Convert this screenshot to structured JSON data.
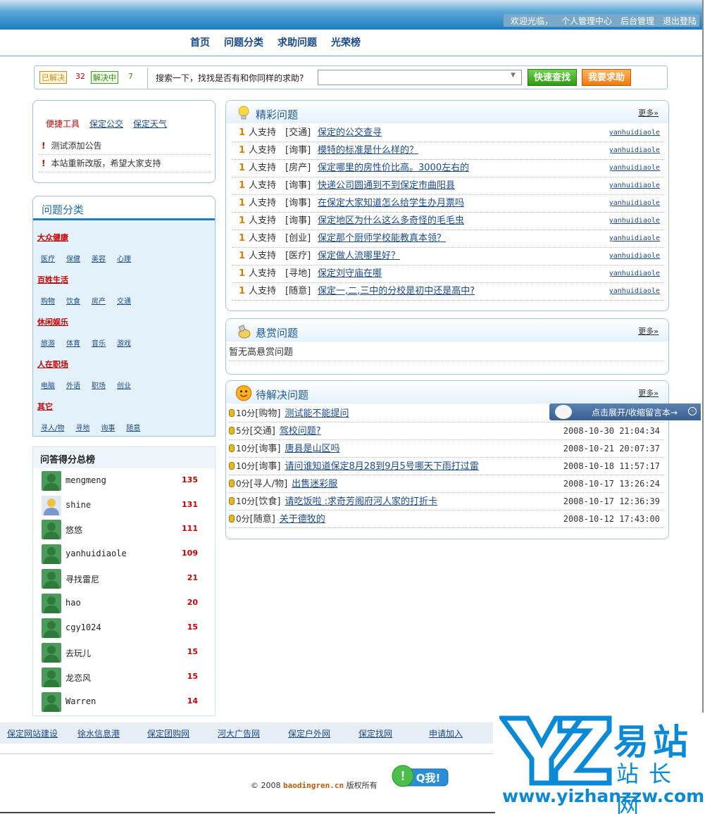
{
  "header": {
    "welcome": "欢迎光临，",
    "links": [
      "个人管理中心",
      "后台管理",
      "退出登陆"
    ]
  },
  "nav": [
    "首页",
    "问题分类",
    "求助问题",
    "光荣榜"
  ],
  "search": {
    "solved_label": "已解决",
    "solved_count": "32",
    "solving_label": "解决中",
    "solving_count": "7",
    "prompt": "搜索一下，找找是否有和你同样的求助?",
    "quick_button": "快速查找",
    "help_button": "我要求助"
  },
  "quick_tools": {
    "title": "便捷工具",
    "links": [
      "保定公交",
      "保定天气"
    ],
    "notices": [
      "测试添加公告",
      "本站重新改版，希望大家支持"
    ]
  },
  "categories": {
    "title": "问题分类",
    "groups": [
      {
        "name": "大众健康",
        "items": [
          "医疗",
          "保健",
          "美容",
          "心理"
        ]
      },
      {
        "name": "百姓生活",
        "items": [
          "购物",
          "饮食",
          "房产",
          "交通"
        ]
      },
      {
        "name": "休闲娱乐",
        "items": [
          "旅游",
          "体育",
          "音乐",
          "游戏"
        ]
      },
      {
        "name": "人在职场",
        "items": [
          "电脑",
          "外语",
          "职场",
          "创业"
        ]
      },
      {
        "name": "其它",
        "items": [
          "寻人/物",
          "寻地",
          "询事",
          "随意"
        ]
      }
    ]
  },
  "ranking": {
    "title": "问答得分总榜",
    "rows": [
      {
        "name": "mengmeng",
        "score": "135"
      },
      {
        "name": "shine",
        "score": "131"
      },
      {
        "name": "悠悠",
        "score": "111"
      },
      {
        "name": "yanhuidiaole",
        "score": "109"
      },
      {
        "name": "寻找雷尼",
        "score": "21"
      },
      {
        "name": "hao",
        "score": "20"
      },
      {
        "name": "cgy1024",
        "score": "15"
      },
      {
        "name": "去玩儿",
        "score": "15"
      },
      {
        "name": "龙恋风",
        "score": "15"
      },
      {
        "name": "Warren",
        "score": "14"
      }
    ]
  },
  "featured": {
    "title": "精彩问题",
    "more": "更多»",
    "rows": [
      {
        "num": "1",
        "support": "人支持",
        "tag": "[交通]",
        "title": "保定的公交查寻",
        "user": "yanhuidiaole"
      },
      {
        "num": "1",
        "support": "人支持",
        "tag": "[询事]",
        "title": "模特的标准是什么样的？",
        "user": "yanhuidiaole"
      },
      {
        "num": "1",
        "support": "人支持",
        "tag": "[房产]",
        "title": "保定哪里的房性价比高。3000左右的",
        "user": "yanhuidiaole"
      },
      {
        "num": "1",
        "support": "人支持",
        "tag": "[询事]",
        "title": "快递公司圆通到不到保定市曲阳县",
        "user": "yanhuidiaole"
      },
      {
        "num": "1",
        "support": "人支持",
        "tag": "[询事]",
        "title": "在保定大家知道怎么给学生办月票吗",
        "user": "yanhuidiaole"
      },
      {
        "num": "1",
        "support": "人支持",
        "tag": "[询事]",
        "title": "保定地区为什么这么多奇怪的毛毛虫",
        "user": "yanhuidiaole"
      },
      {
        "num": "1",
        "support": "人支持",
        "tag": "[创业]",
        "title": "保定那个厨师学校能教真本领？",
        "user": "yanhuidiaole"
      },
      {
        "num": "1",
        "support": "人支持",
        "tag": "[医疗]",
        "title": "保定做人流哪里好？",
        "user": "yanhuidiaole"
      },
      {
        "num": "1",
        "support": "人支持",
        "tag": "[寻地]",
        "title": "保定刘守庙在哪",
        "user": "yanhuidiaole"
      },
      {
        "num": "1",
        "support": "人支持",
        "tag": "[随意]",
        "title": "保定一,二,三中的分校是初中还是高中?",
        "user": "yanhuidiaole"
      }
    ]
  },
  "reward": {
    "title": "悬赏问题",
    "more": "更多»",
    "empty": "暂无高悬赏问题"
  },
  "pending": {
    "title": "待解决问题",
    "more": "更多»",
    "rows": [
      {
        "pts": "10分",
        "tag": "[购物]",
        "title": "测试能不能提问",
        "date": ""
      },
      {
        "pts": "5分",
        "tag": "[交通]",
        "title": "驾校问题?",
        "date": "2008-10-30 21:04:34"
      },
      {
        "pts": "10分",
        "tag": "[询事]",
        "title": "唐县是山区吗",
        "date": "2008-10-21 20:07:37"
      },
      {
        "pts": "10分",
        "tag": "[询事]",
        "title": "请问谁知道保定8月28到9月5号哪天下雨打过雷",
        "date": "2008-10-18 11:57:17"
      },
      {
        "pts": "0分",
        "tag": "[寻人/物]",
        "title": "出售迷彩服",
        "date": "2008-10-17 13:26:24"
      },
      {
        "pts": "10分",
        "tag": "[饮食]",
        "title": "请吃饭啦 :求奇芳阁府河人家的打折卡",
        "date": "2008-10-17 12:36:39"
      },
      {
        "pts": "0分",
        "tag": "[随意]",
        "title": "关于德牧的",
        "date": "2008-10-12 17:43:00"
      }
    ]
  },
  "float_bar": {
    "text": "点击展开/收缩留言本→"
  },
  "footer": {
    "links": [
      "保定网站建设",
      "徐水信息港",
      "保定团购网",
      "河大广告网",
      "保定户外网",
      "保定找网",
      "申请加入"
    ],
    "copyright_prefix": "© 2008",
    "domain": "baodingren.cn",
    "copyright_suffix": "版权所有",
    "qq": "Q我!"
  },
  "watermark": {
    "cn_top": "易站",
    "cn_bottom": "站长网",
    "url": "www.yizhanzzw.com"
  }
}
